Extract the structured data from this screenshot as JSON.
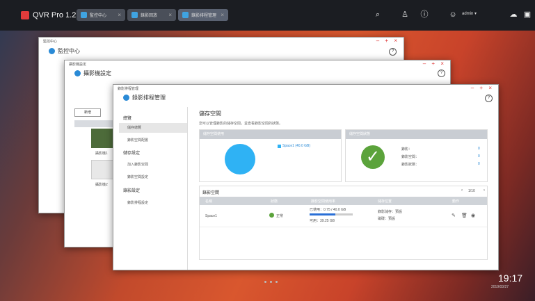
{
  "app": {
    "title": "QVR Pro 1.2"
  },
  "tabs": [
    {
      "label": "監控中心"
    },
    {
      "label": "錄影回放"
    },
    {
      "label": "錄影排程管理"
    }
  ],
  "topbar": {
    "user": "admin ▾"
  },
  "win_back": {
    "titlebar": "監控中心",
    "heading": "監控中心"
  },
  "win_mid": {
    "titlebar": "攝影機設定",
    "heading": "攝影機設定",
    "add_button": "新增",
    "cam1_label": "攝影機1",
    "cam2_label": "攝影機2"
  },
  "win_front": {
    "titlebar": "錄影排程管理",
    "heading": "錄影排程管理",
    "sidebar": {
      "section1": "總覽",
      "section1_items": [
        "儲存總覽",
        "錄影空間配置"
      ],
      "section2": "儲存設定",
      "section2_items": [
        "加入錄影空間",
        "錄影空間設定"
      ],
      "section3": "錄影設定",
      "section3_items": [
        "錄影排程設定"
      ]
    },
    "main": {
      "title": "儲存空間",
      "desc": "您可以管理錄影的儲存空間，並查看錄影空間的狀態。",
      "panel1_title": "儲存空間使用",
      "legend": "Space1 (40.0 GB)",
      "panel2_title": "儲存空間狀態",
      "status_rows": [
        {
          "label": "錄影：",
          "value": "0"
        },
        {
          "label": "錄影空間：",
          "value": "0"
        },
        {
          "label": "錄影狀態：",
          "value": "0"
        }
      ],
      "table_title": "錄影空間",
      "pager": "1/10",
      "columns": [
        "名稱",
        "狀態",
        "錄影空間使用率",
        "儲存位置",
        "動作"
      ],
      "row": {
        "name": "Space1",
        "status": "正常",
        "usage1": "已使用：0.75 / 40.0 GB",
        "usage2": "可用：39.25 GB",
        "loc1": "錄影儲存：預設",
        "loc2": "磁碟：預設"
      },
      "usage_fraction": 0.6
    }
  },
  "clock": {
    "time": "19:17",
    "date": "2019/03/27"
  }
}
